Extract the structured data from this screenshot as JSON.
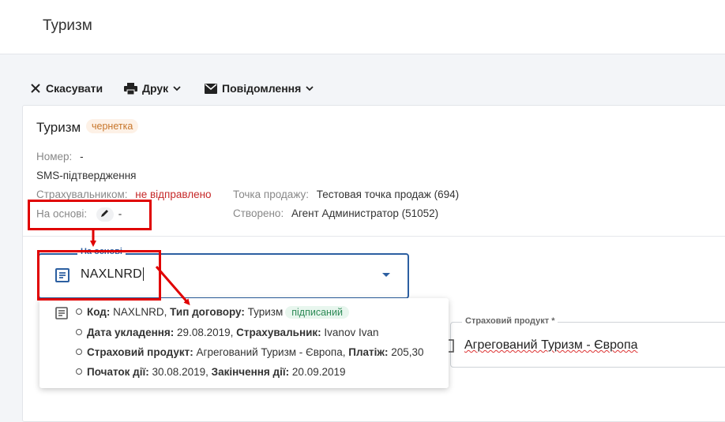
{
  "app": {
    "title": "Туризм"
  },
  "toolbar": {
    "cancel_label": "Скасувати",
    "print_label": "Друк",
    "notify_label": "Повідомлення"
  },
  "document": {
    "title": "Туризм",
    "status": "чернетка",
    "number_label": "Номер:",
    "number_value": "-",
    "sms_heading": "SMS-підтвердження",
    "insurer_label": "Страхувальником:",
    "insurer_value": "не відправлено",
    "basis_label": "На основі:",
    "basis_value": "-",
    "sale_point_label": "Точка продажу:",
    "sale_point_value": "Тестовая точка продаж (694)",
    "created_label": "Створено:",
    "created_value": "Агент Администратор (51052)"
  },
  "basis_field": {
    "legend": "На основі",
    "value": "NAXLNRD"
  },
  "product_field": {
    "legend": "Страховий продукт *",
    "value": "Агрегований Туризм - Європа"
  },
  "dropdown_option": {
    "code_label": "Код:",
    "code_value": "NAXLNRD,",
    "type_label": "Тип договору:",
    "type_value": "Туризм",
    "status": "підписаний",
    "date_label": "Дата укладення:",
    "date_value": "29.08.2019,",
    "insurer_label": "Страхувальник:",
    "insurer_value": "Ivanov Ivan",
    "product_label": "Страховий продукт:",
    "product_value": "Агрегований Туризм - Європа,",
    "payment_label": "Платіж:",
    "payment_value": "205,30",
    "start_label": "Початок дії:",
    "start_value": "30.08.2019,",
    "end_label": "Закінчення дії:",
    "end_value": "20.09.2019"
  },
  "colors": {
    "accent": "#2c5fa1",
    "draft": "#c7762b",
    "signed": "#2e8b57",
    "annotation": "#e00000"
  }
}
